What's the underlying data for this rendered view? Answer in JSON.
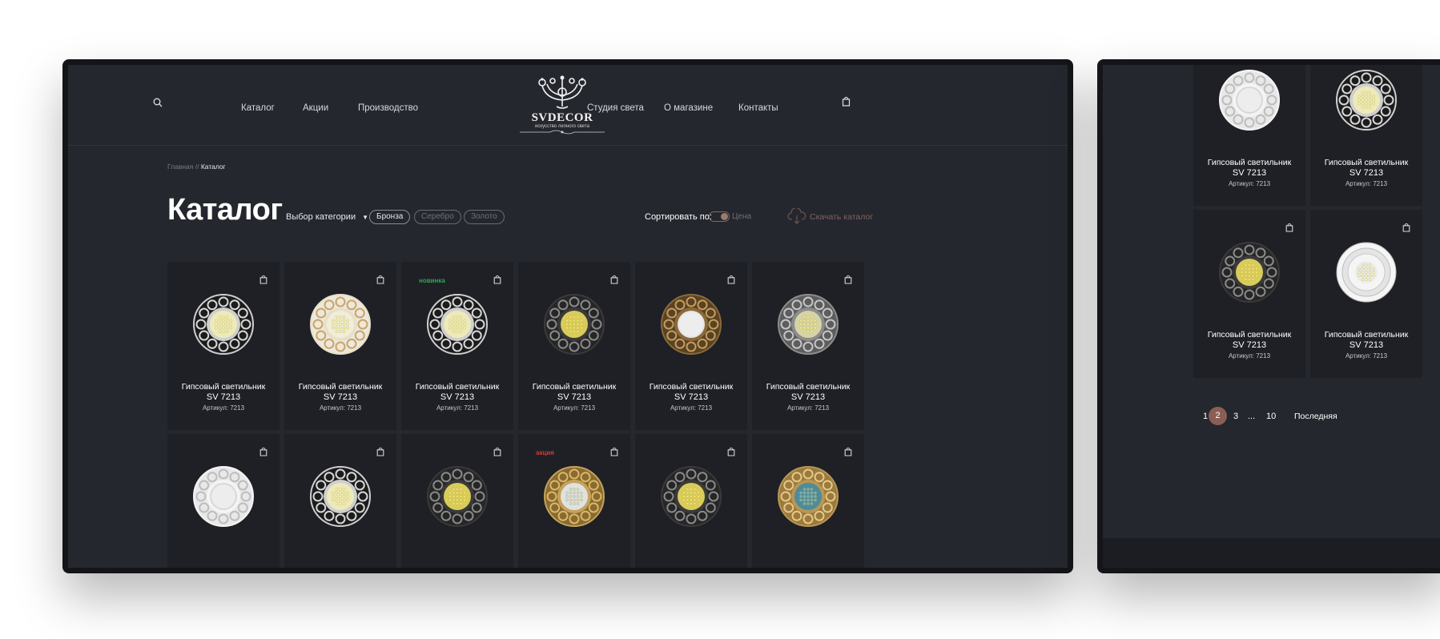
{
  "header": {
    "nav_left": [
      "Каталог",
      "Акции",
      "Производство"
    ],
    "nav_right": [
      "Студия света",
      "О магазине",
      "Контакты"
    ],
    "logo_title": "SVDECOR",
    "logo_subtitle": "искусство лепного света"
  },
  "breadcrumb": {
    "home": "Главная",
    "separator": "//",
    "current": "Каталог"
  },
  "page": {
    "title": "Каталог"
  },
  "filters": {
    "category_label": "Выбор категории",
    "chips": [
      "Бронза",
      "Серебро",
      "Золото"
    ],
    "sort_label": "Сортировать по:",
    "sort_value": "Цена",
    "download_label": "Скачать каталог"
  },
  "products": [
    {
      "name": "Гипсовый светильник",
      "sku": "SV 7213",
      "article": "Артикул: 7213",
      "badge": "",
      "style": "silver-scroll"
    },
    {
      "name": "Гипсовый светильник",
      "sku": "SV 7213",
      "article": "Артикул: 7213",
      "badge": "",
      "style": "ivory-gold"
    },
    {
      "name": "Гипсовый светильник",
      "sku": "SV 7213",
      "article": "Артикул: 7213",
      "badge": "новинка",
      "style": "silver-scroll"
    },
    {
      "name": "Гипсовый светильник",
      "sku": "SV 7213",
      "article": "Артикул: 7213",
      "badge": "",
      "style": "dark-silver"
    },
    {
      "name": "Гипсовый светильник",
      "sku": "SV 7213",
      "article": "Артикул: 7213",
      "badge": "",
      "style": "bronze-frosted"
    },
    {
      "name": "Гипсовый светильник",
      "sku": "SV 7213",
      "article": "Артикул: 7213",
      "badge": "",
      "style": "silver-twist"
    },
    {
      "name": "",
      "sku": "",
      "article": "",
      "badge": "",
      "style": "white-frosted"
    },
    {
      "name": "",
      "sku": "",
      "article": "",
      "badge": "",
      "style": "silver-scroll"
    },
    {
      "name": "",
      "sku": "",
      "article": "",
      "badge": "",
      "style": "dark-silver"
    },
    {
      "name": "",
      "sku": "",
      "article": "",
      "badge": "акция",
      "style": "gold"
    },
    {
      "name": "",
      "sku": "",
      "article": "",
      "badge": "",
      "style": "dark-silver"
    },
    {
      "name": "",
      "sku": "",
      "article": "",
      "badge": "",
      "style": "gold-greek"
    }
  ],
  "side_products": [
    {
      "name": "Гипсовый светильник",
      "sku": "SV 7213",
      "article": "Артикул: 7213",
      "style": "white-frosted"
    },
    {
      "name": "Гипсовый светильник",
      "sku": "SV 7213",
      "article": "Артикул: 7213",
      "style": "silver-scroll"
    },
    {
      "name": "Гипсовый светильник",
      "sku": "SV 7213",
      "article": "Артикул: 7213",
      "style": "dark-silver"
    },
    {
      "name": "Гипсовый светильник",
      "sku": "SV 7213",
      "article": "Артикул: 7213",
      "style": "white-tiered"
    }
  ],
  "pagination": {
    "pages": [
      "1",
      "2",
      "3",
      "...",
      "10"
    ],
    "current": "2",
    "last_label": "Последняя"
  },
  "colors": {
    "background": "#25272e",
    "card": "#1e2026",
    "accent": "#8b5e54",
    "new_badge": "#2ea84f",
    "sale_badge": "#d23a32"
  },
  "icons": [
    "search-icon",
    "cart-icon",
    "download-cloud-icon",
    "chevron-down-icon",
    "bag-icon"
  ]
}
